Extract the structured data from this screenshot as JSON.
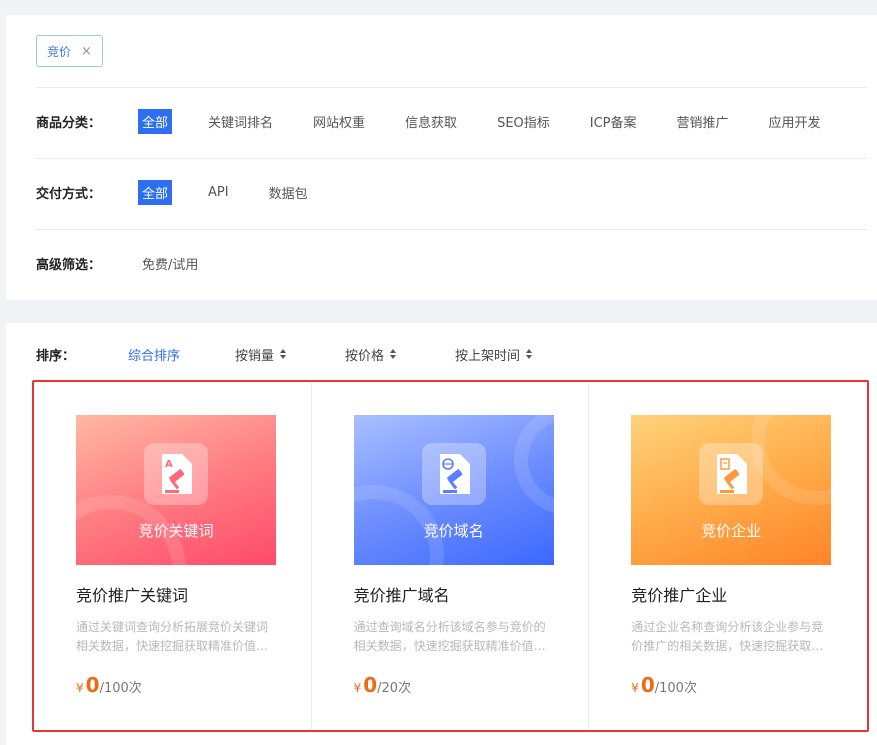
{
  "active_tag": {
    "label": "竞价",
    "close": "×"
  },
  "filters": {
    "category": {
      "label": "商品分类：",
      "options": [
        "全部",
        "关键词排名",
        "网站权重",
        "信息获取",
        "SEO指标",
        "ICP备案",
        "营销推广",
        "应用开发"
      ],
      "selected": "全部"
    },
    "delivery": {
      "label": "交付方式：",
      "options": [
        "全部",
        "API",
        "数据包"
      ],
      "selected": "全部"
    },
    "advanced": {
      "label": "高级筛选：",
      "options": [
        "免费/试用"
      ]
    }
  },
  "sort": {
    "label": "排序：",
    "items": [
      "综合排序",
      "按销量",
      "按价格",
      "按上架时间"
    ],
    "active": "综合排序"
  },
  "colors": {
    "accent": "#2d6ff0",
    "price": "#f06a13",
    "highlight": "#e53535"
  },
  "products": [
    {
      "cover_title": "竞价关键词",
      "icon": "auction-keyword-icon",
      "title": "竞价推广关键词",
      "desc": "通过关键词查询分析拓展竞价关键词相关数据，快速挖掘获取精准价值…",
      "currency": "¥",
      "price": "0",
      "unit": "/100次",
      "gradient": [
        "#ffb3a0",
        "#ff4a68"
      ]
    },
    {
      "cover_title": "竞价域名",
      "icon": "auction-domain-icon",
      "title": "竞价推广域名",
      "desc": "通过查询域名分析该域名参与竞价的相关数据，快速挖掘获取精准价值…",
      "currency": "¥",
      "price": "0",
      "unit": "/20次",
      "gradient": [
        "#9bb4ff",
        "#3d6bff"
      ]
    },
    {
      "cover_title": "竞价企业",
      "icon": "auction-company-icon",
      "title": "竞价推广企业",
      "desc": "通过企业名称查询分析该企业参与竞价推广的相关数据，快速挖掘获取…",
      "currency": "¥",
      "price": "0",
      "unit": "/100次",
      "gradient": [
        "#ffd37a",
        "#ff8a2a"
      ]
    }
  ]
}
